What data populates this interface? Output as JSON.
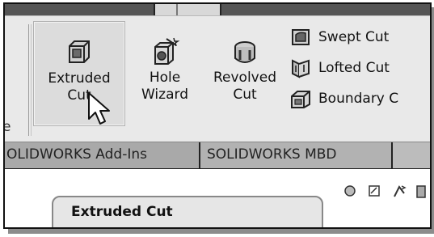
{
  "ribbon": {
    "edge_label": "e",
    "buttons": {
      "extruded_cut": {
        "line1": "Extruded",
        "line2": "Cut",
        "icon": "extruded-cut-icon"
      },
      "hole_wizard": {
        "line1": "Hole",
        "line2": "Wizard",
        "icon": "hole-wizard-icon"
      },
      "revolved_cut": {
        "line1": "Revolved",
        "line2": "Cut",
        "icon": "revolved-cut-icon"
      }
    },
    "small_buttons": [
      {
        "label": "Swept Cut",
        "icon": "swept-cut-icon"
      },
      {
        "label": "Lofted Cut",
        "icon": "lofted-cut-icon"
      },
      {
        "label": "Boundary C",
        "icon": "boundary-cut-icon"
      }
    ]
  },
  "tabs": [
    {
      "label": "OLIDWORKS Add-Ins"
    },
    {
      "label": "SOLIDWORKS MBD"
    }
  ],
  "tooltip": {
    "text": "Extruded Cut"
  },
  "colors": {
    "ribbon": "#e9e9e9",
    "tab": "#a9a9a9",
    "tooltip": "#e6e6e6"
  }
}
